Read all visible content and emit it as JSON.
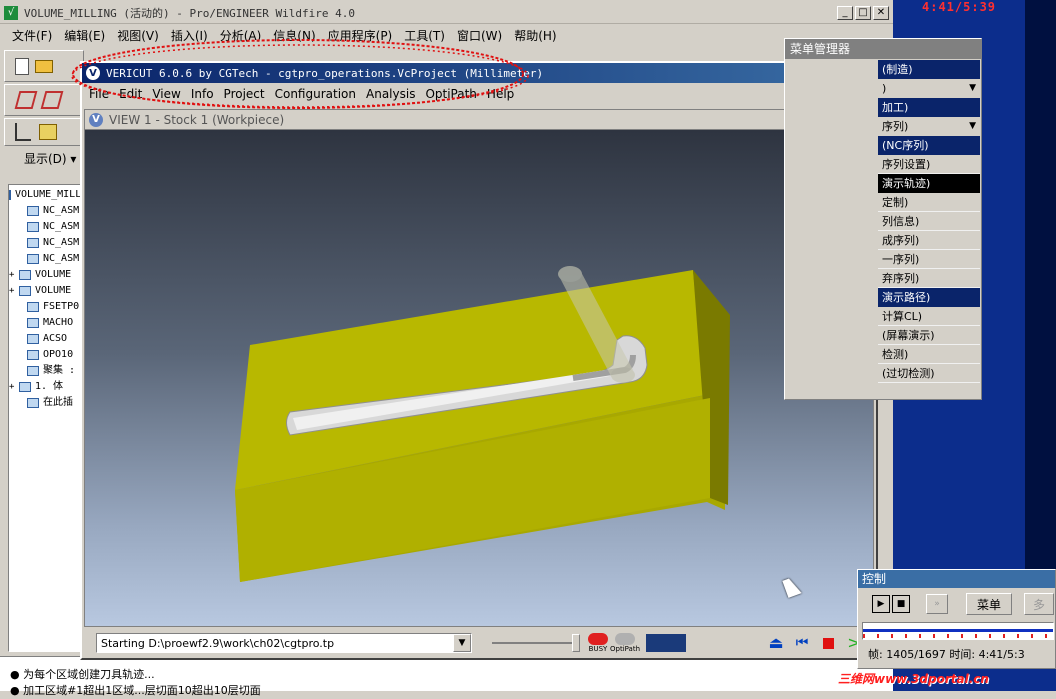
{
  "proe": {
    "title": "VOLUME_MILLING (活动的) - Pro/ENGINEER Wildfire 4.0",
    "menu": [
      "文件(F)",
      "编辑(E)",
      "视图(V)",
      "插入(I)",
      "分析(A)",
      "信息(N)",
      "应用程序(P)",
      "工具(T)",
      "窗口(W)",
      "帮助(H)"
    ],
    "display_label": "显示(D) ▾",
    "tree": [
      {
        "label": "VOLUME_MILLING",
        "level": 0,
        "expand": ""
      },
      {
        "label": "NC_ASM",
        "level": 1,
        "expand": ""
      },
      {
        "label": "NC_ASM",
        "level": 1,
        "expand": ""
      },
      {
        "label": "NC_ASM",
        "level": 1,
        "expand": ""
      },
      {
        "label": "NC_ASM",
        "level": 1,
        "expand": ""
      },
      {
        "label": "VOLUME",
        "level": 0,
        "expand": "+"
      },
      {
        "label": "VOLUME",
        "level": 0,
        "expand": "+"
      },
      {
        "label": "FSETP0",
        "level": 1,
        "expand": ""
      },
      {
        "label": "MACHO",
        "level": 1,
        "expand": ""
      },
      {
        "label": "ACSO",
        "level": 1,
        "expand": ""
      },
      {
        "label": "OPO10",
        "level": 1,
        "expand": ""
      },
      {
        "label": "聚集 :",
        "level": 1,
        "expand": ""
      },
      {
        "label": "1. 体",
        "level": 0,
        "expand": "+"
      },
      {
        "label": "在此插",
        "level": 1,
        "expand": ""
      }
    ],
    "messages": [
      "● 为每个区域创建刀具轨迹...",
      "● 加工区域#1超出1区域...层切面10超出10层切面"
    ]
  },
  "vericut": {
    "title": "VERICUT 6.0.6 by CGTech - cgtpro_operations.VcProject (Millimeter)",
    "menu": [
      "File",
      "Edit",
      "View",
      "Info",
      "Project",
      "Configuration",
      "Analysis",
      "OptiPath",
      "Help"
    ],
    "view_title": "VIEW 1 - Stock 1 (Workpiece)",
    "status_path": "Starting D:\\proewf2.9\\work\\ch02\\cgtpro.tp",
    "busy_label": "BUSY",
    "optipath_label": "OptiPath"
  },
  "menu_manager": {
    "title": "菜单管理器",
    "rows": [
      {
        "text": "(制造)",
        "style": "hdr",
        "dropdown": false
      },
      {
        "text": ")",
        "style": "normal",
        "dropdown": true
      },
      {
        "text": "加工)",
        "style": "hdr",
        "dropdown": false
      },
      {
        "text": "序列)",
        "style": "normal",
        "dropdown": true
      },
      {
        "text": "(NC序列)",
        "style": "hdr",
        "dropdown": false
      },
      {
        "text": "序列设置)",
        "style": "normal",
        "dropdown": false
      },
      {
        "text": "演示轨迹)",
        "style": "sel",
        "dropdown": false
      },
      {
        "text": "定制)",
        "style": "normal",
        "dropdown": false
      },
      {
        "text": "列信息)",
        "style": "normal",
        "dropdown": false
      },
      {
        "text": "成序列)",
        "style": "normal",
        "dropdown": false
      },
      {
        "text": "一序列)",
        "style": "normal",
        "dropdown": false
      },
      {
        "text": "弃序列)",
        "style": "normal",
        "dropdown": false
      },
      {
        "text": "演示路径)",
        "style": "hdr",
        "dropdown": false
      },
      {
        "text": "计算CL)",
        "style": "normal",
        "dropdown": false
      },
      {
        "text": "(屏幕演示)",
        "style": "normal",
        "dropdown": false
      },
      {
        "text": "检测)",
        "style": "normal",
        "dropdown": false
      },
      {
        "text": "(过切检测)",
        "style": "normal",
        "dropdown": false
      }
    ]
  },
  "control": {
    "title": "控制",
    "menu_button": "菜单",
    "more_button": "多",
    "frame_label": "帧: 1405/1697 时间: 4:41/5:3"
  },
  "clock": "4:41/5:39",
  "watermark": "三维网www.3dportal.cn",
  "colors": {
    "accent": "#0a246a",
    "part": "#c8c800",
    "annotation": "#e01010"
  }
}
